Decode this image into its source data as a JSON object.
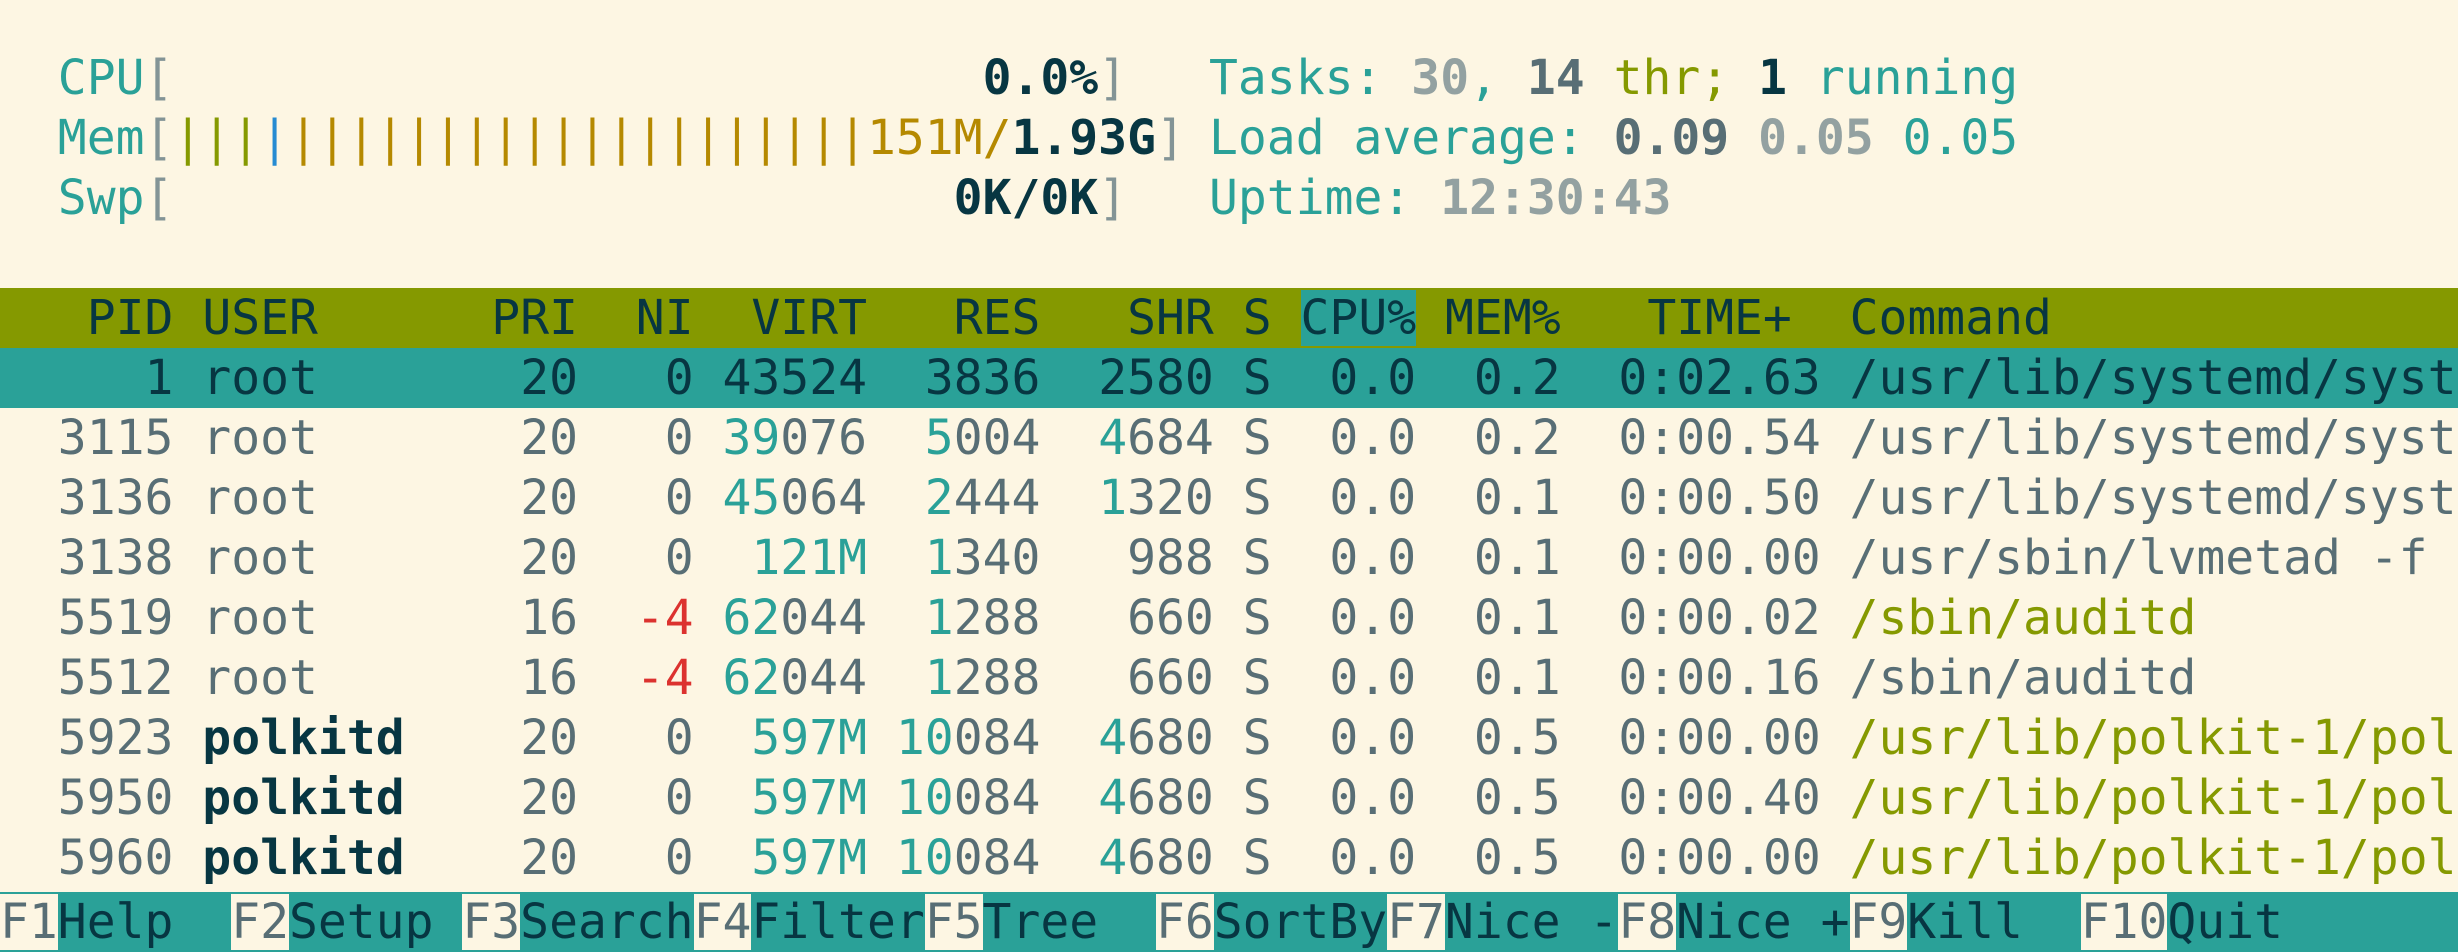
{
  "meters": {
    "cpu": {
      "label": "CPU",
      "bar": "",
      "value": "0.0%"
    },
    "mem": {
      "label": "Mem",
      "bar_a": "|||",
      "bar_b": "|",
      "bar_c": "||||||||||||||||||||",
      "used": "151M/",
      "total": "1.93G"
    },
    "swp": {
      "label": "Swp",
      "value": "0K/0K"
    }
  },
  "stats": {
    "tasks_label": "Tasks: ",
    "tasks": "30",
    "sep1": ", ",
    "threads": "14",
    "thr_label": " thr; ",
    "running": "1",
    "running_label": " running",
    "load_label": "Load average: ",
    "load1": "0.09",
    "load5": "0.05",
    "load15": "0.05",
    "uptime_label": "Uptime: ",
    "uptime": "12:30:43"
  },
  "columns": {
    "pid": "PID",
    "user": "USER",
    "pri": "PRI",
    "ni": "NI",
    "virt": "VIRT",
    "res": "RES",
    "shr": "SHR",
    "s": "S",
    "cpu": "CPU%",
    "mem": "MEM%",
    "time": "TIME+",
    "command": "Command"
  },
  "processes": [
    {
      "pid": "1",
      "user": "root",
      "pri": "20",
      "ni": "0",
      "virt": "43524",
      "res": "3836",
      "shr": "2580",
      "s": "S",
      "cpu": "0.0",
      "mem": "0.2",
      "time": "0:02.63",
      "command": "/usr/lib/systemd/syst"
    },
    {
      "pid": "3115",
      "user": "root",
      "pri": "20",
      "ni": "0",
      "virt": "39076",
      "res": "5004",
      "shr": "4684",
      "s": "S",
      "cpu": "0.0",
      "mem": "0.2",
      "time": "0:00.54",
      "command": "/usr/lib/systemd/syst"
    },
    {
      "pid": "3136",
      "user": "root",
      "pri": "20",
      "ni": "0",
      "virt": "45064",
      "res": "2444",
      "shr": "1320",
      "s": "S",
      "cpu": "0.0",
      "mem": "0.1",
      "time": "0:00.50",
      "command": "/usr/lib/systemd/syst"
    },
    {
      "pid": "3138",
      "user": "root",
      "pri": "20",
      "ni": "0",
      "virt": "121M",
      "res": "1340",
      "shr": "988",
      "s": "S",
      "cpu": "0.0",
      "mem": "0.1",
      "time": "0:00.00",
      "command": "/usr/sbin/lvmetad -f"
    },
    {
      "pid": "5519",
      "user": "root",
      "pri": "16",
      "ni": "-4",
      "virt": "62044",
      "res": "1288",
      "shr": "660",
      "s": "S",
      "cpu": "0.0",
      "mem": "0.1",
      "time": "0:00.02",
      "command": "/sbin/auditd"
    },
    {
      "pid": "5512",
      "user": "root",
      "pri": "16",
      "ni": "-4",
      "virt": "62044",
      "res": "1288",
      "shr": "660",
      "s": "S",
      "cpu": "0.0",
      "mem": "0.1",
      "time": "0:00.16",
      "command": "/sbin/auditd"
    },
    {
      "pid": "5923",
      "user": "polkitd",
      "pri": "20",
      "ni": "0",
      "virt": "597M",
      "res": "10084",
      "shr": "4680",
      "s": "S",
      "cpu": "0.0",
      "mem": "0.5",
      "time": "0:00.00",
      "command": "/usr/lib/polkit-1/pol"
    },
    {
      "pid": "5950",
      "user": "polkitd",
      "pri": "20",
      "ni": "0",
      "virt": "597M",
      "res": "10084",
      "shr": "4680",
      "s": "S",
      "cpu": "0.0",
      "mem": "0.5",
      "time": "0:00.40",
      "command": "/usr/lib/polkit-1/pol"
    },
    {
      "pid": "5960",
      "user": "polkitd",
      "pri": "20",
      "ni": "0",
      "virt": "597M",
      "res": "10084",
      "shr": "4680",
      "s": "S",
      "cpu": "0.0",
      "mem": "0.5",
      "time": "0:00.00",
      "command": "/usr/lib/polkit-1/pol"
    }
  ],
  "fkeys": [
    {
      "key": "F1",
      "label": "Help  "
    },
    {
      "key": "F2",
      "label": "Setup "
    },
    {
      "key": "F3",
      "label": "Search"
    },
    {
      "key": "F4",
      "label": "Filter"
    },
    {
      "key": "F5",
      "label": "Tree  "
    },
    {
      "key": "F6",
      "label": "SortBy"
    },
    {
      "key": "F7",
      "label": "Nice -"
    },
    {
      "key": "F8",
      "label": "Nice +"
    },
    {
      "key": "F9",
      "label": "Kill  "
    },
    {
      "key": "F10",
      "label": "Quit      "
    }
  ],
  "colors": {
    "background": "#fdf6e3",
    "header": "#859900",
    "selection": "#2aa198",
    "accent": "#2aa198"
  }
}
